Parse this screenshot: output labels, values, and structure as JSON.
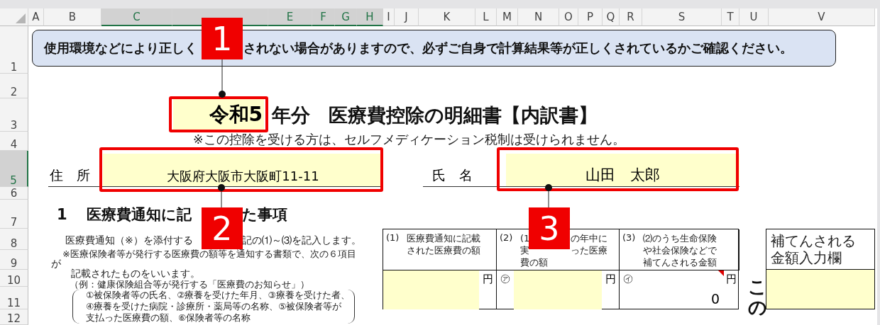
{
  "columns": [
    {
      "label": "A",
      "selected": false
    },
    {
      "label": "B",
      "selected": false
    },
    {
      "label": "C",
      "selected": true
    },
    {
      "selected": true
    },
    {
      "label": "E",
      "selected": true
    },
    {
      "label": "F",
      "selected": true
    },
    {
      "label": "G",
      "selected": true
    },
    {
      "label": "H",
      "selected": true
    },
    {
      "label": "I",
      "selected": false
    },
    {
      "label": "J",
      "selected": false
    },
    {
      "label": "K",
      "selected": false
    },
    {
      "label": "L",
      "selected": false
    },
    {
      "label": "M",
      "selected": false
    },
    {
      "label": "N",
      "selected": false
    },
    {
      "label": "O",
      "selected": false
    },
    {
      "label": "P",
      "selected": false
    },
    {
      "label": "Q",
      "selected": false
    },
    {
      "label": "R",
      "selected": false
    },
    {
      "label": "S",
      "selected": false
    },
    {
      "label": "T",
      "selected": false
    },
    {
      "label": "U",
      "selected": false
    },
    {
      "label": "V",
      "selected": false
    }
  ],
  "rows": [
    {
      "label": "1",
      "selected": false
    },
    {
      "label": "2",
      "selected": false
    },
    {
      "label": "3",
      "selected": false
    },
    {
      "label": "4",
      "selected": false
    },
    {
      "label": "5",
      "selected": true
    },
    {
      "label": "6",
      "selected": false
    },
    {
      "label": "7",
      "selected": false
    },
    {
      "label": "8",
      "selected": false
    },
    {
      "label": "9",
      "selected": false
    },
    {
      "label": "10",
      "selected": false
    },
    {
      "label": "11",
      "selected": false
    },
    {
      "label": "12",
      "selected": false
    }
  ],
  "notice": [
    "使用環境などにより正しく",
    "されない場合がありますので、必ずご自身で計算結果等が正しくされているかご確認ください。"
  ],
  "title": {
    "era": "令和5",
    "suffix": "年分",
    "text": "医療費控除の明細書【内訳書】"
  },
  "subtitle": "※この控除を受ける方は、セルフメディケーション税制は受けられません。",
  "address": {
    "label": "住　所",
    "value": "大阪府大阪市大阪町11-11"
  },
  "name": {
    "label": "氏　名",
    "value": "山田　太郎"
  },
  "section": {
    "number": "1",
    "title": [
      "医療費通知に記",
      "た事項"
    ]
  },
  "notes": [
    [
      "医療費通知（※）を添付する",
      "記の⑴～⑶を記入します。"
    ],
    [
      "※医療保険者等が発行する医療費の額等を通知する書類で、次の６項目"
    ],
    [
      "が"
    ],
    [
      "記載されたものをいいます。"
    ],
    [
      "（例：健康保険組合等が発行する「医療費のお知らせ」）"
    ]
  ],
  "items": [
    "①被保険者等の氏名、②療養を受けた年月、③療養を受けた者、",
    "④療養を受けた病院・診療所・薬局等の名称、⑤被保険者等が",
    "支払った医療費の額、⑥保険者等の名称"
  ],
  "table": {
    "headers": [
      {
        "number": "(1)",
        "lines": [
          [
            "医療費通知に記載"
          ],
          [
            "された医療費の額"
          ]
        ]
      },
      {
        "number": "(2)",
        "lines": [
          [
            "(1",
            "の年中に"
          ],
          [
            "実",
            "った医療"
          ],
          [
            "費の額"
          ]
        ]
      },
      {
        "number": "(3)",
        "lines": [
          [
            "⑵のうち生命保険"
          ],
          [
            "や社会保険などで"
          ],
          [
            "補てんされる金額"
          ]
        ]
      }
    ],
    "cells": [
      {
        "input": true,
        "unit": "円",
        "comment": false
      },
      {
        "mark": "㋐",
        "input": true,
        "unit": "円",
        "comment": false
      },
      {
        "mark": "㋑",
        "input": false,
        "unit": "円",
        "value": "0",
        "comment": true
      }
    ]
  },
  "vertical_text": "この",
  "supplement": {
    "label": [
      "補てんされる",
      "金額入力欄"
    ]
  },
  "callouts": [
    {
      "number": "1"
    },
    {
      "number": "2"
    },
    {
      "number": "3"
    }
  ]
}
